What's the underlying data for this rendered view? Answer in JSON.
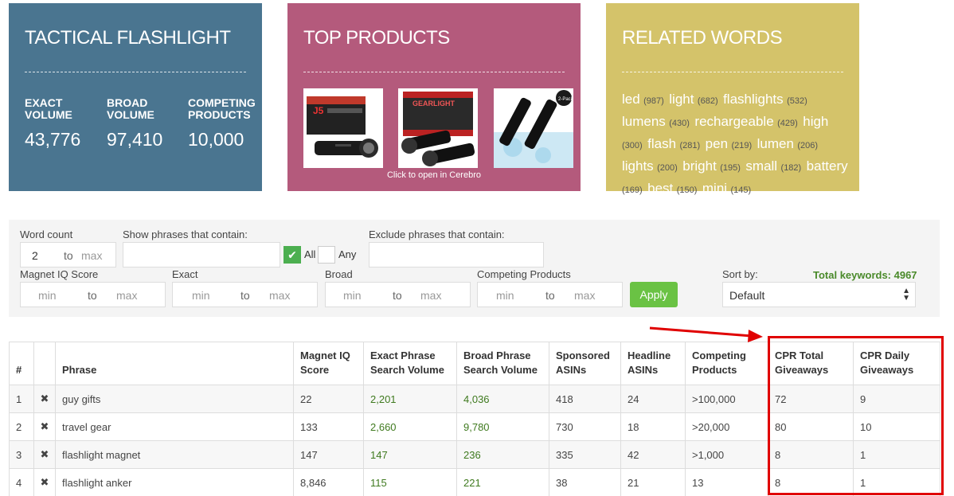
{
  "cards": {
    "tactical": {
      "title": "TACTICAL FLASHLIGHT",
      "stats": [
        {
          "label": "EXACT VOLUME",
          "value": "43,776"
        },
        {
          "label": "BROAD VOLUME",
          "value": "97,410"
        },
        {
          "label": "COMPETING PRODUCTS",
          "value": "10,000"
        }
      ],
      "color": "#4a7590"
    },
    "top_products": {
      "title": "TOP PRODUCTS",
      "link": "Click to open in Cerebro",
      "color": "#b45a7c"
    },
    "related": {
      "title": "RELATED WORDS",
      "color": "#d4c36a",
      "words": [
        {
          "word": "led",
          "count": "(987)"
        },
        {
          "word": "light",
          "count": "(682)"
        },
        {
          "word": "flashlights",
          "count": "(532)"
        },
        {
          "word": "lumens",
          "count": "(430)"
        },
        {
          "word": "rechargeable",
          "count": "(429)"
        },
        {
          "word": "high",
          "count": "(300)"
        },
        {
          "word": "flash",
          "count": "(281)"
        },
        {
          "word": "pen",
          "count": "(219)"
        },
        {
          "word": "lumen",
          "count": "(206)"
        },
        {
          "word": "lights",
          "count": "(200)"
        },
        {
          "word": "bright",
          "count": "(195)"
        },
        {
          "word": "small",
          "count": "(182)"
        },
        {
          "word": "battery",
          "count": "(169)"
        },
        {
          "word": "best",
          "count": "(150)"
        },
        {
          "word": "mini",
          "count": "(145)"
        }
      ]
    }
  },
  "filters": {
    "word_count_label": "Word count",
    "word_count_min": "2",
    "to": "to",
    "max": "max",
    "min": "min",
    "show_label": "Show phrases that contain:",
    "all_label": "All",
    "any_label": "Any",
    "exclude_label": "Exclude phrases that contain:",
    "magnet_label": "Magnet IQ Score",
    "exact_label": "Exact",
    "broad_label": "Broad",
    "competing_label": "Competing Products",
    "apply_label": "Apply",
    "sort_label": "Sort by:",
    "sort_value": "Default",
    "total_keywords": "Total keywords: 4967"
  },
  "table": {
    "headers": [
      "#",
      "",
      "Phrase",
      "Magnet IQ Score",
      "Exact Phrase Search Volume",
      "Broad Phrase Search Volume",
      "Sponsored ASINs",
      "Headline ASINs",
      "Competing Products",
      "CPR Total Giveaways",
      "CPR Daily Giveaways"
    ],
    "remove_symbol": "✖",
    "rows": [
      [
        "1",
        "guy gifts",
        "22",
        "2,201",
        "4,036",
        "418",
        "24",
        ">100,000",
        "72",
        "9"
      ],
      [
        "2",
        "travel gear",
        "133",
        "2,660",
        "9,780",
        "730",
        "18",
        ">20,000",
        "80",
        "10"
      ],
      [
        "3",
        "flashlight magnet",
        "147",
        "147",
        "236",
        "335",
        "42",
        ">1,000",
        "8",
        "1"
      ],
      [
        "4",
        "flashlight anker",
        "8,846",
        "115",
        "221",
        "38",
        "21",
        "13",
        "8",
        "1"
      ]
    ]
  },
  "annotation_color": "#e00000"
}
